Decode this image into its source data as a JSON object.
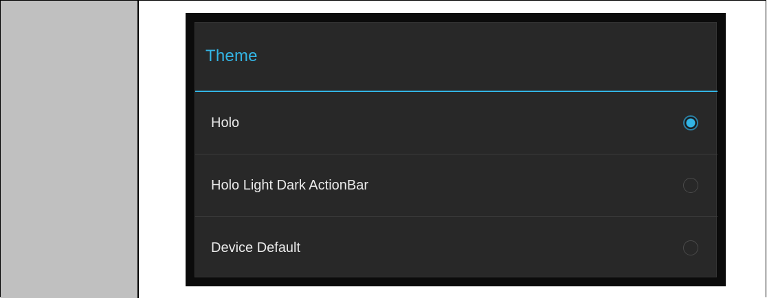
{
  "dialog": {
    "title": "Theme",
    "accent": "#33b5e5",
    "options": [
      {
        "label": "Holo",
        "selected": true
      },
      {
        "label": "Holo Light Dark ActionBar",
        "selected": false
      },
      {
        "label": "Device Default",
        "selected": false
      }
    ]
  }
}
